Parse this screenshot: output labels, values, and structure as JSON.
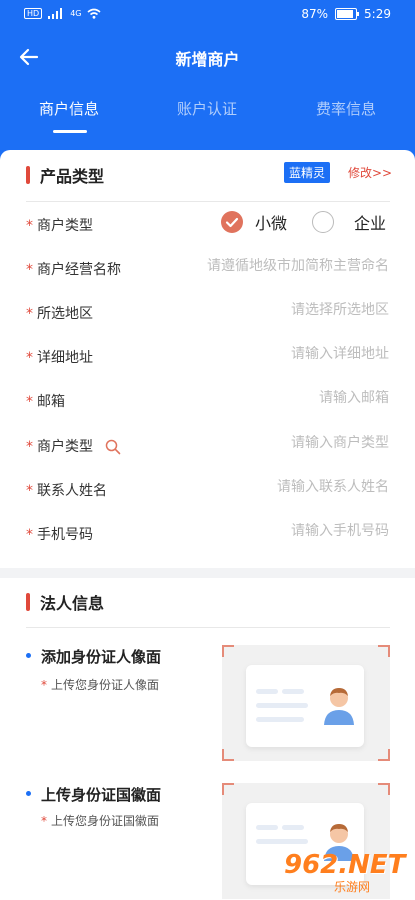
{
  "statusbar": {
    "hd": "HD",
    "net": "4G",
    "battery": "87%",
    "time": "5:29"
  },
  "header": {
    "title": "新增商户"
  },
  "tabs": [
    {
      "label": "商户信息",
      "active": true
    },
    {
      "label": "账户认证",
      "active": false
    },
    {
      "label": "费率信息",
      "active": false
    }
  ],
  "product": {
    "section_title": "产品类型",
    "tag": "蓝精灵",
    "modify": "修改>>"
  },
  "form": {
    "merchant_type": {
      "label": "商户类型",
      "options": [
        "小微",
        "企业"
      ],
      "selected": "小微"
    },
    "business_name": {
      "label": "商户经营名称",
      "placeholder": "请遵循地级市加简称主营命名"
    },
    "region": {
      "label": "所选地区",
      "placeholder": "请选择所选地区"
    },
    "address": {
      "label": "详细地址",
      "placeholder": "请输入详细地址"
    },
    "email": {
      "label": "邮箱",
      "placeholder": "请输入邮箱"
    },
    "merchant_category": {
      "label": "商户类型",
      "placeholder": "请输入商户类型"
    },
    "contact_name": {
      "label": "联系人姓名",
      "placeholder": "请输入联系人姓名"
    },
    "phone": {
      "label": "手机号码",
      "placeholder": "请输入手机号码"
    }
  },
  "legal": {
    "section_title": "法人信息",
    "uploads": [
      {
        "title": "添加身份证人像面",
        "sub": "上传您身份证人像面"
      },
      {
        "title": "上传身份证国徽面",
        "sub": "上传您身份证国徽面"
      }
    ]
  },
  "watermark": {
    "main": "962.NET",
    "sub": "乐游网"
  },
  "colors": {
    "primary": "#1c6ff5",
    "accent": "#e0493b",
    "radio": "#e0735d"
  },
  "icons": {
    "back": "arrow-left-icon",
    "search": "search-icon",
    "check": "check-icon"
  }
}
